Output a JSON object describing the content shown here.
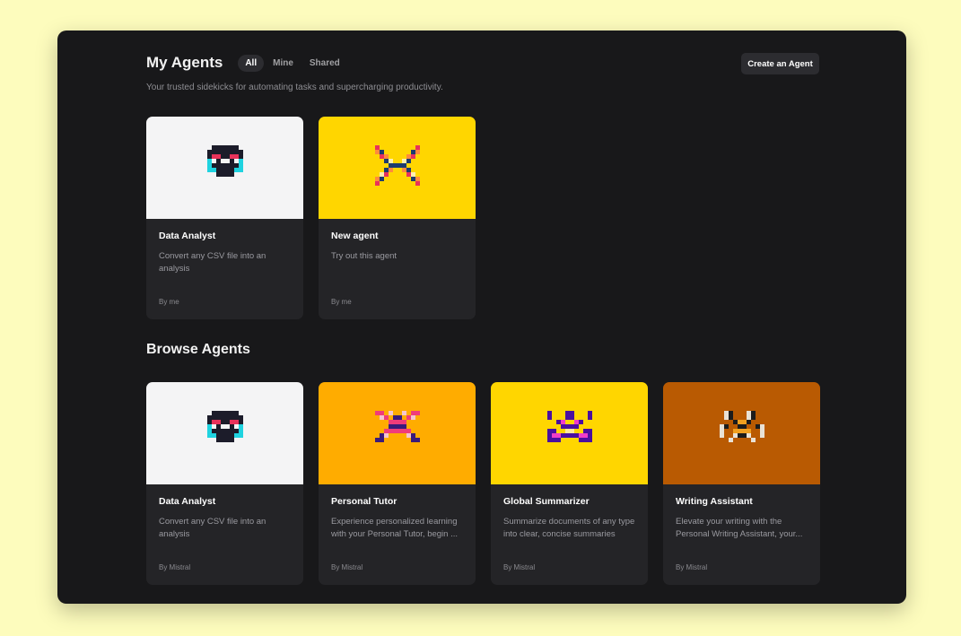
{
  "header": {
    "title": "My Agents",
    "tabs": [
      {
        "label": "All",
        "active": true
      },
      {
        "label": "Mine",
        "active": false
      },
      {
        "label": "Shared",
        "active": false
      }
    ],
    "subtitle": "Your trusted sidekicks for automating tasks and supercharging productivity.",
    "create_label": "Create an Agent"
  },
  "my_agents": [
    {
      "name": "Data Analyst",
      "desc": "Convert any CSV file into an analysis",
      "author": "By me",
      "bg": "#f4f4f5",
      "icon": "robot-face-icon"
    },
    {
      "name": "New agent",
      "desc": "Try out this agent",
      "author": "By me",
      "bg": "#ffd600",
      "icon": "pixel-x-icon"
    }
  ],
  "browse": {
    "title": "Browse Agents",
    "items": [
      {
        "name": "Data Analyst",
        "desc": "Convert any CSV file into an analysis",
        "author": "By Mistral",
        "bg": "#f4f4f5",
        "icon": "robot-face-icon"
      },
      {
        "name": "Personal Tutor",
        "desc": "Experience personalized learning with your Personal Tutor, begin ...",
        "author": "By Mistral",
        "bg": "#ffac00",
        "icon": "pixel-x-icon"
      },
      {
        "name": "Global Summarizer",
        "desc": "Summarize documents of any type into clear, concise summaries",
        "author": "By Mistral",
        "bg": "#ffd600",
        "icon": "pixel-crab-icon"
      },
      {
        "name": "Writing Assistant",
        "desc": "Elevate your writing with the Personal Writing Assistant, your...",
        "author": "By Mistral",
        "bg": "#b95a02",
        "icon": "pixel-bear-icon"
      }
    ]
  }
}
